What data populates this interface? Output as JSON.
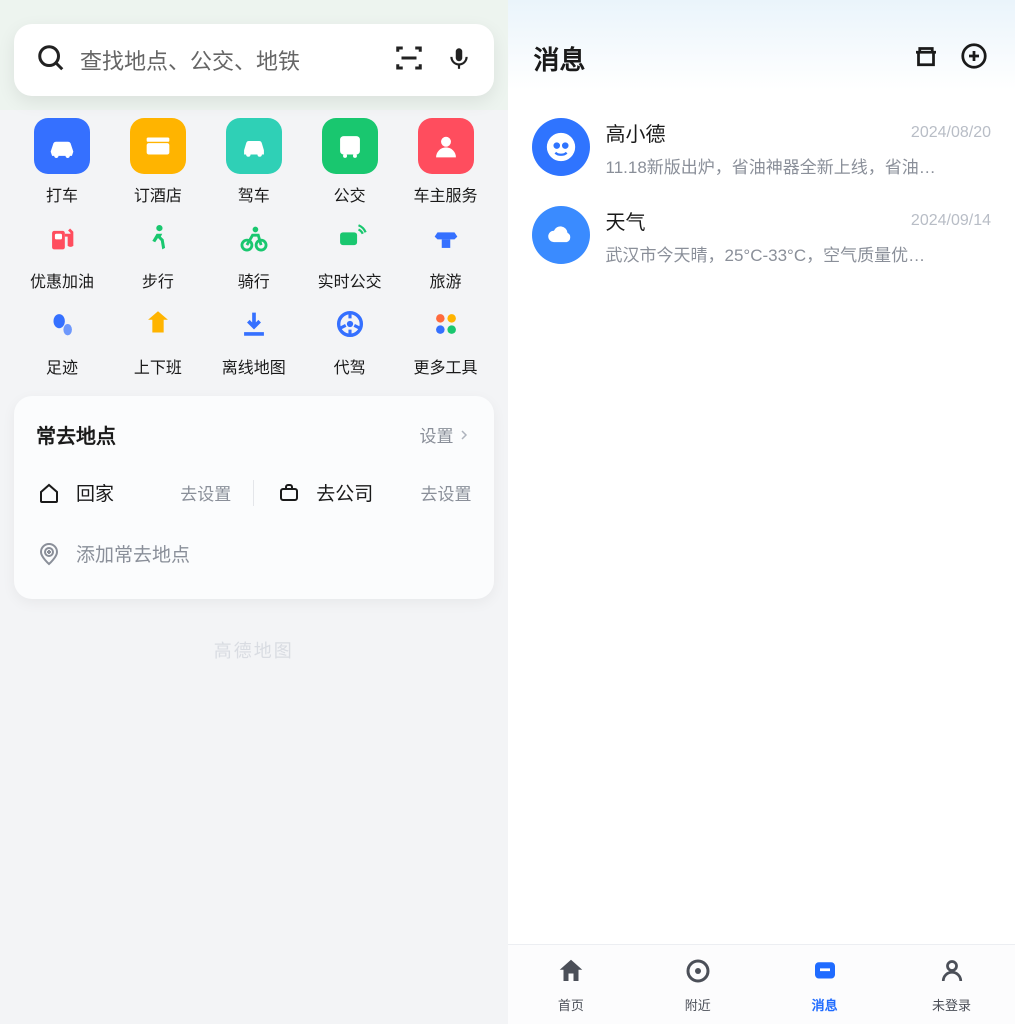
{
  "search": {
    "placeholder": "查找地点、公交、地铁"
  },
  "shortcuts_row1": [
    {
      "key": "taxi",
      "label": "打车",
      "bg": "#3570ff",
      "icon": "taxi"
    },
    {
      "key": "hotel",
      "label": "订酒店",
      "bg": "#ffb400",
      "icon": "hotel"
    },
    {
      "key": "drive",
      "label": "驾车",
      "bg": "#2fd0b6",
      "icon": "car"
    },
    {
      "key": "bus",
      "label": "公交",
      "bg": "#19c76f",
      "icon": "bus"
    },
    {
      "key": "owner",
      "label": "车主服务",
      "bg": "#ff4d5e",
      "icon": "owner"
    }
  ],
  "shortcuts_row2": [
    {
      "key": "gas",
      "label": "优惠加油",
      "color": "#ff4d5e",
      "icon": "gas"
    },
    {
      "key": "walk",
      "label": "步行",
      "color": "#19c76f",
      "icon": "walk"
    },
    {
      "key": "bike",
      "label": "骑行",
      "color": "#19c76f",
      "icon": "bike"
    },
    {
      "key": "rtbus",
      "label": "实时公交",
      "color": "#19c76f",
      "icon": "rtbus"
    },
    {
      "key": "travel",
      "label": "旅游",
      "color": "#3570ff",
      "icon": "travel"
    }
  ],
  "shortcuts_row3": [
    {
      "key": "footprint",
      "label": "足迹",
      "color": "#3570ff",
      "icon": "footprint"
    },
    {
      "key": "commute",
      "label": "上下班",
      "color": "#ffb400",
      "icon": "commute"
    },
    {
      "key": "offline",
      "label": "离线地图",
      "color": "#3570ff",
      "icon": "download"
    },
    {
      "key": "daijia",
      "label": "代驾",
      "color": "#3570ff",
      "icon": "wheel"
    },
    {
      "key": "more",
      "label": "更多工具",
      "color": "#ff8a3d",
      "icon": "more"
    }
  ],
  "favorites": {
    "title": "常去地点",
    "setting_label": "设置",
    "home_label": "回家",
    "home_action": "去设置",
    "company_label": "去公司",
    "company_action": "去设置",
    "add_label": "添加常去地点"
  },
  "watermark": "高德地图",
  "right": {
    "title": "消息",
    "messages": [
      {
        "name": "高小德",
        "date": "2024/08/20",
        "preview": "11.18新版出炉，省油神器全新上线，省油…",
        "avatar_bg": "#2f74ff",
        "avatar": "gaoxiaode"
      },
      {
        "name": "天气",
        "date": "2024/09/14",
        "preview": "武汉市今天晴，25°C-33°C，空气质量优…",
        "avatar_bg": "#3a8bff",
        "avatar": "cloud"
      }
    ]
  },
  "nav": [
    {
      "key": "home",
      "label": "首页"
    },
    {
      "key": "nearby",
      "label": "附近"
    },
    {
      "key": "message",
      "label": "消息"
    },
    {
      "key": "profile",
      "label": "未登录"
    }
  ],
  "left_active_nav": "home",
  "right_active_nav": "message"
}
